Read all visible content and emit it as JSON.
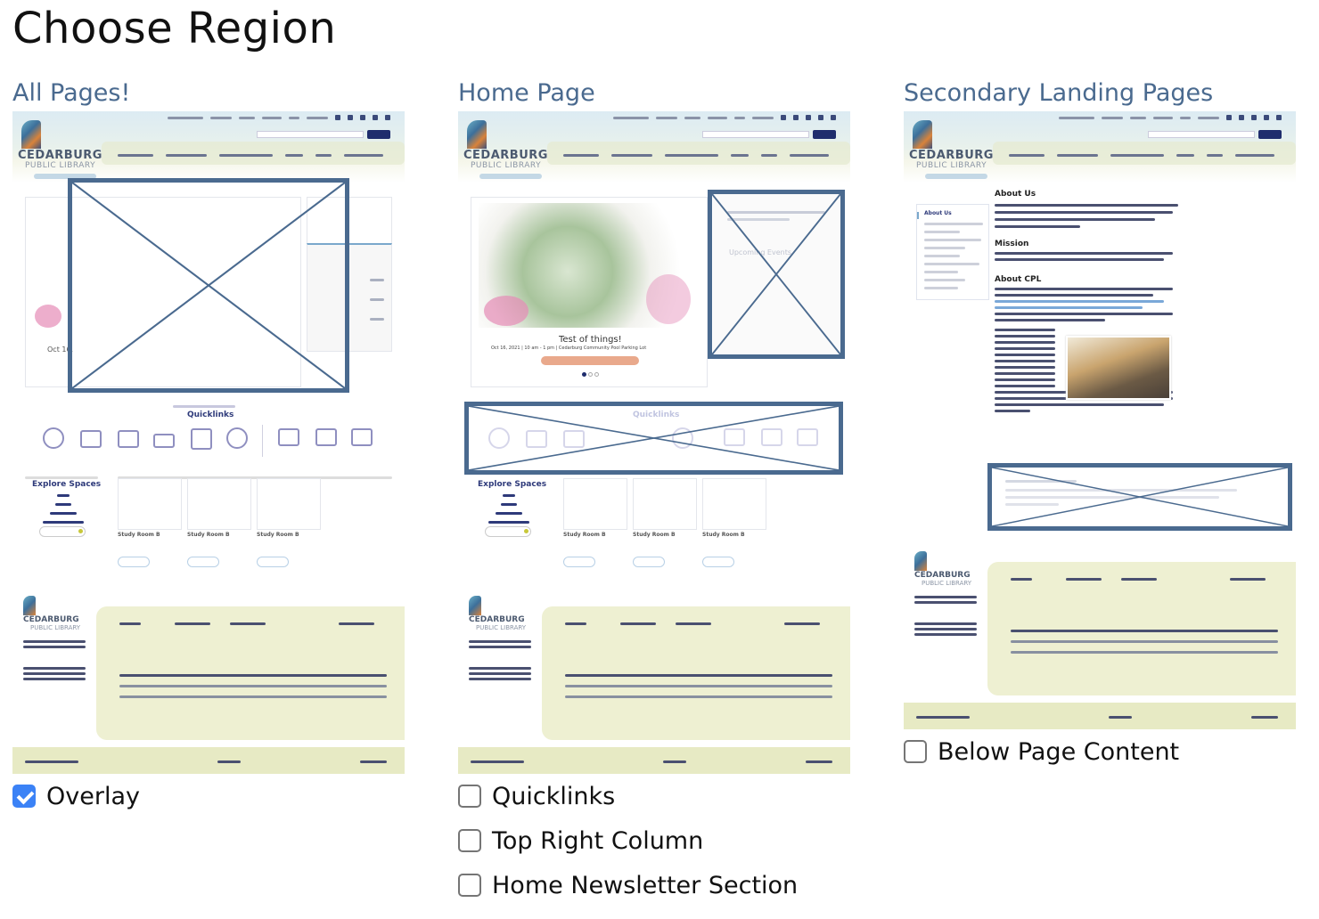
{
  "page": {
    "title": "Choose Region"
  },
  "columns": [
    {
      "title": "All Pages!",
      "thumbnail": {
        "site": {
          "logo_line1": "CEDARBURG",
          "logo_line2": "PUBLIC LIBRARY"
        },
        "quicklinks_title": "Quicklinks",
        "explore_title": "Explore Spaces",
        "room_title": "Study Room B",
        "event_date": "Oct 16,"
      },
      "options": [
        {
          "label": "Overlay",
          "checked": true
        }
      ]
    },
    {
      "title": "Home Page",
      "thumbnail": {
        "site": {
          "logo_line1": "CEDARBURG",
          "logo_line2": "PUBLIC LIBRARY"
        },
        "hero_title": "Test of things!",
        "hero_meta": "Oct 16, 2021 | 10 am - 1 pm | Cedarburg Community Pool Parking Lot",
        "sidebar_title": "Upcoming Events",
        "quicklinks_title": "Quicklinks",
        "explore_title": "Explore Spaces",
        "room_title": "Study Room B"
      },
      "options": [
        {
          "label": "Quicklinks",
          "checked": false
        },
        {
          "label": "Top Right Column",
          "checked": false
        },
        {
          "label": "Home Newsletter Section",
          "checked": false
        }
      ]
    },
    {
      "title": "Secondary Landing Pages",
      "thumbnail": {
        "site": {
          "logo_line1": "CEDARBURG",
          "logo_line2": "PUBLIC LIBRARY"
        },
        "headings": [
          "About Us",
          "Mission",
          "About CPL"
        ],
        "subnav_active": "About Us"
      },
      "options": [
        {
          "label": "Below Page Content",
          "checked": false
        }
      ]
    }
  ],
  "colors": {
    "heading_blue": "#4a6a8f",
    "overlay_frame": "#4a6a8f",
    "checkbox_checked": "#3b82f6",
    "footer_green": "#eef0d2"
  }
}
